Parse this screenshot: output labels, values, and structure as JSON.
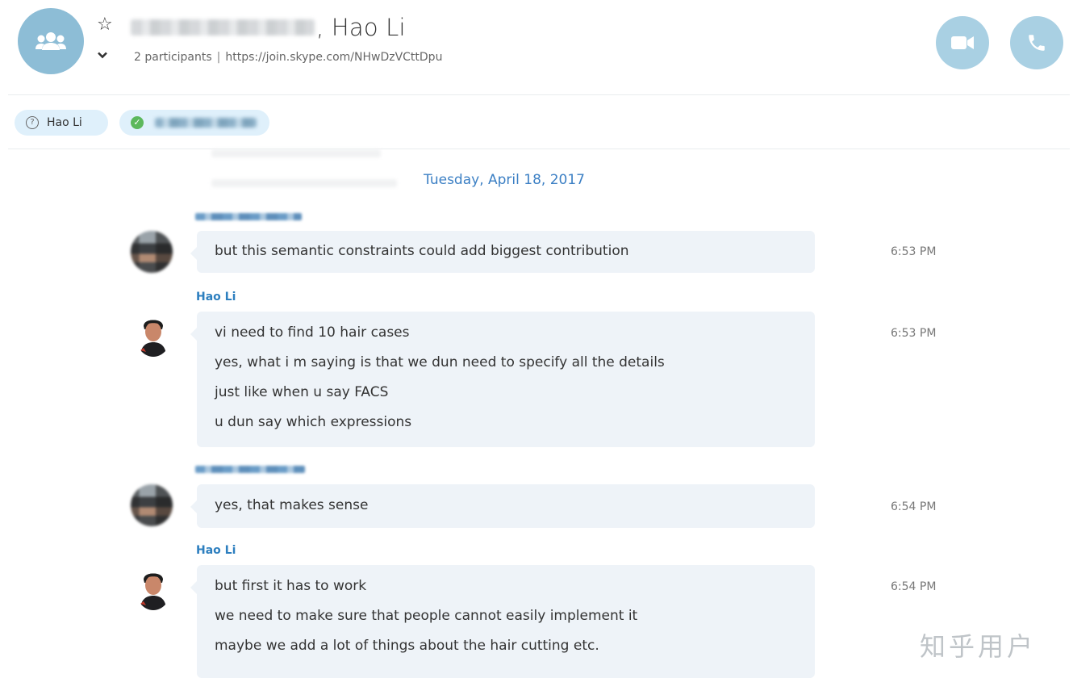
{
  "header": {
    "title_suffix": ", Hao Li",
    "participants": "2 participants",
    "separator": "|",
    "join_link": "https://join.skype.com/NHwDzVCttDpu"
  },
  "participants_bar": {
    "items": [
      {
        "label": "Hao Li",
        "status": "unknown"
      },
      {
        "label": "",
        "status": "online"
      }
    ]
  },
  "conversation": {
    "date": "Tuesday, April 18, 2017",
    "messages": [
      {
        "sender": "",
        "time": "6:53 PM",
        "lines": [
          "but this semantic constraints could add biggest contribution"
        ]
      },
      {
        "sender": "Hao Li",
        "time": "6:53 PM",
        "lines": [
          "vi need to find 10 hair cases",
          "yes, what i m saying is that we dun need to specify all the details",
          "just like when u say FACS",
          "u dun say which expressions"
        ]
      },
      {
        "sender": "",
        "time": "6:54 PM",
        "lines": [
          "yes, that makes sense"
        ]
      },
      {
        "sender": "Hao Li",
        "time": "6:54 PM",
        "lines": [
          "but first it has to work",
          "we need to make sure that people cannot easily implement it",
          "maybe we add a lot of things about the hair cutting etc."
        ]
      }
    ]
  },
  "watermark": "知乎用户",
  "colors": {
    "accent": "#3b7fc4",
    "sender": "#2d7fbf",
    "bubble": "#eef3f8",
    "call_button": "#a9d0e3",
    "chip": "#dff0fb",
    "online": "#5cb85c"
  }
}
